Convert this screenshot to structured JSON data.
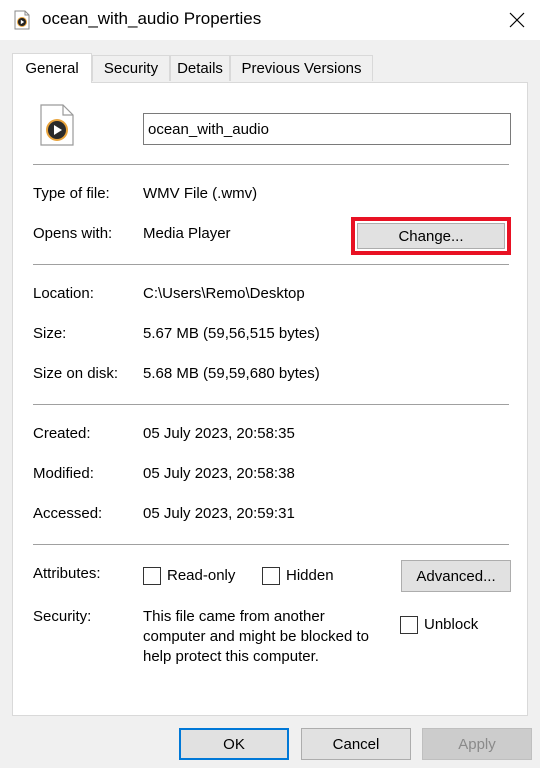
{
  "window": {
    "title": "ocean_with_audio Properties",
    "close_glyph": "✕"
  },
  "tabs": [
    {
      "label": "General",
      "active": true
    },
    {
      "label": "Security",
      "active": false
    },
    {
      "label": "Details",
      "active": false
    },
    {
      "label": "Previous Versions",
      "active": false
    }
  ],
  "file": {
    "name": "ocean_with_audio",
    "icon": "media-player-file-icon"
  },
  "type_section": {
    "type_label": "Type of file:",
    "type_value": "WMV File (.wmv)",
    "opens_label": "Opens with:",
    "opens_value": "Media Player",
    "change_button": "Change..."
  },
  "location_section": {
    "location_label": "Location:",
    "location_value": "C:\\Users\\Remo\\Desktop",
    "size_label": "Size:",
    "size_value": "5.67 MB (59,56,515 bytes)",
    "size_on_disk_label": "Size on disk:",
    "size_on_disk_value": "5.68 MB (59,59,680 bytes)"
  },
  "dates_section": {
    "created_label": "Created:",
    "created_value": "05 July 2023, 20:58:35",
    "modified_label": "Modified:",
    "modified_value": "05 July 2023, 20:58:38",
    "accessed_label": "Accessed:",
    "accessed_value": "05 July 2023, 20:59:31"
  },
  "attributes_section": {
    "attributes_label": "Attributes:",
    "readonly_label": "Read-only",
    "readonly_checked": false,
    "hidden_label": "Hidden",
    "hidden_checked": false,
    "advanced_button": "Advanced...",
    "security_label": "Security:",
    "security_line1": "This file came from another",
    "security_line2": "computer and might be blocked to",
    "security_line3": "help protect this computer.",
    "unblock_label": "Unblock",
    "unblock_checked": false
  },
  "footer": {
    "ok": "OK",
    "cancel": "Cancel",
    "apply": "Apply"
  },
  "colors": {
    "highlight": "#e81123",
    "ok_border": "#0078d7",
    "icon_orange": "#e8a33c"
  }
}
